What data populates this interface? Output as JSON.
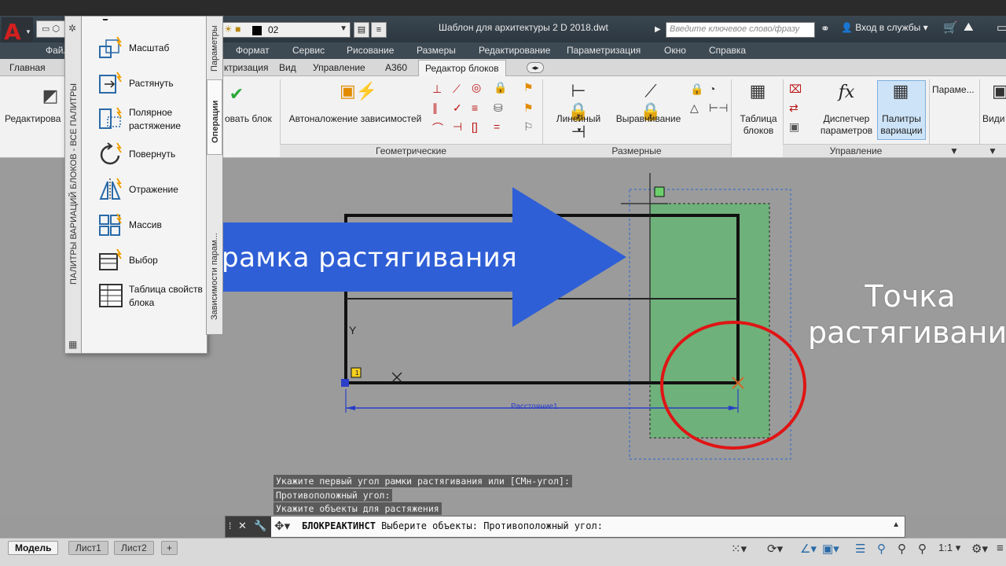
{
  "title_bar": {
    "app_logo": "A",
    "layer_name": "02",
    "window_title": "Шаблон для архитектуры 2 D 2018.dwt",
    "search_placeholder": "Введите ключевое слово/фразу",
    "login_label": "Вход в службы"
  },
  "menu": [
    "Файл",
    "Формат",
    "Сервис",
    "Рисование",
    "Размеры",
    "Редактирование",
    "Параметризация",
    "Окно",
    "Справка"
  ],
  "ribbon_tabs": [
    "Главная",
    "ктризация",
    "Вид",
    "Управление",
    "A360",
    "Редактор блоков"
  ],
  "active_tab": "Редактор блоков",
  "ribbon": {
    "edit_label": "Редактирова",
    "save_block_label": "овать блок",
    "auto_constraint_label": "Автоналожение зависимостей",
    "geometric_panel": "Геометрические",
    "linear_label": "Линейный",
    "align_label": "Выравнивание",
    "dimensional_panel": "Размерные",
    "block_table_label_1": "Таблица",
    "block_table_label_2": "блоков",
    "param_manager_label_1": "Диспетчер",
    "param_manager_label_2": "параметров",
    "variation_palettes_label_1": "Палитры",
    "variation_palettes_label_2": "вариации",
    "manage_panel": "Управление",
    "params_label": "Параме...",
    "view_label": "Види",
    "fx": "fx"
  },
  "palette": {
    "title": "ПАЛИТРЫ ВАРИАЦИЙ БЛОКОВ - ВСЕ ПАЛИТРЫ",
    "items": [
      {
        "label": "Масштаб"
      },
      {
        "label": "Растянуть"
      },
      {
        "label": "Полярное растяжение"
      },
      {
        "label": "Повернуть"
      },
      {
        "label": "Отражение"
      },
      {
        "label": "Массив"
      },
      {
        "label": "Выбор"
      },
      {
        "label": "Таблица свойств блока"
      }
    ],
    "tabs": [
      "Параметры",
      "Операции",
      "Зависимости парам..."
    ]
  },
  "drawing": {
    "y_label": "Y",
    "x_label": "X",
    "dimension_label": "Расстояние1",
    "grip_number": "1"
  },
  "annotations": {
    "arrow_text": "рамка растягивания",
    "point_text_1": "Точка",
    "point_text_2": "растягивания"
  },
  "command_history": [
    "Укажите первый угол рамки растягивания или [СМн-угол]:",
    "Противоположный угол:",
    "Укажите объекты для растяжения"
  ],
  "command_line": {
    "command": "БЛОКРЕАКТИНСТ",
    "prompt": "Выберите объекты: Противоположный угол:"
  },
  "status_tabs": [
    "Модель",
    "Лист1",
    "Лист2"
  ],
  "scale": "1:1",
  "colors": {
    "arrow": "#2f5fd6",
    "circle": "#e01515",
    "stretch_frame": "#3d6fc8",
    "green_fill": "#66b574"
  }
}
